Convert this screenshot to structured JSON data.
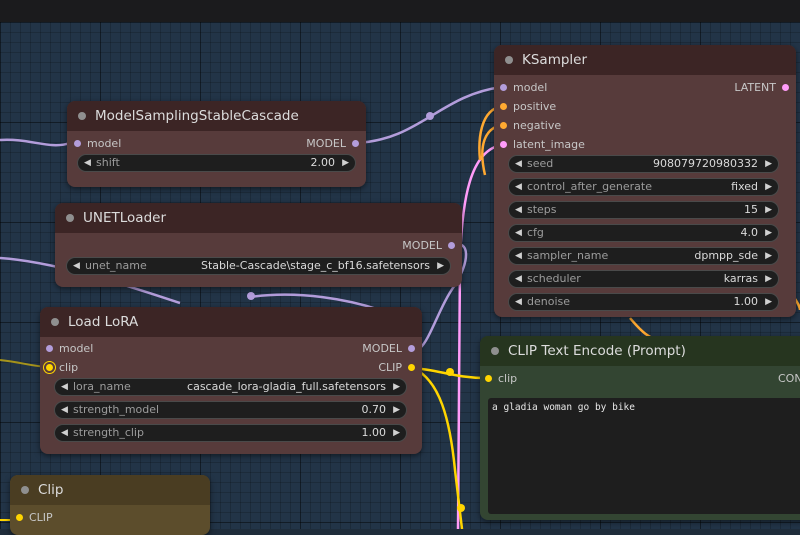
{
  "colors": {
    "model": "#b39ddb",
    "clip": "#ffd500",
    "conditioning": "#ffa931",
    "latent": "#ff9cf9",
    "node_body": "#573b3b",
    "node_title": "#3c2525",
    "canvas": "#223447"
  },
  "ksampler": {
    "title": "KSampler",
    "inputs": [
      "model",
      "positive",
      "negative",
      "latent_image"
    ],
    "output": "LATENT",
    "widgets": [
      {
        "label": "seed",
        "value": "908079720980332"
      },
      {
        "label": "control_after_generate",
        "value": "fixed"
      },
      {
        "label": "steps",
        "value": "15"
      },
      {
        "label": "cfg",
        "value": "4.0"
      },
      {
        "label": "sampler_name",
        "value": "dpmpp_sde"
      },
      {
        "label": "scheduler",
        "value": "karras"
      },
      {
        "label": "denoise",
        "value": "1.00"
      }
    ]
  },
  "model_sampling": {
    "title": "ModelSamplingStableCascade",
    "input": "model",
    "output": "MODEL",
    "widget": {
      "label": "shift",
      "value": "2.00"
    }
  },
  "unet_loader": {
    "title": "UNETLoader",
    "output": "MODEL",
    "widget": {
      "label": "unet_name",
      "value": "Stable-Cascade\\stage_c_bf16.safetensors"
    }
  },
  "load_lora": {
    "title": "Load LoRA",
    "inputs": [
      "model",
      "clip"
    ],
    "outputs": [
      "MODEL",
      "CLIP"
    ],
    "widgets": [
      {
        "label": "lora_name",
        "value": "cascade_lora-gladia_full.safetensors"
      },
      {
        "label": "strength_model",
        "value": "0.70"
      },
      {
        "label": "strength_clip",
        "value": "1.00"
      }
    ]
  },
  "clip_text_encode": {
    "title": "CLIP Text Encode (Prompt)",
    "input": "clip",
    "output_partial": "CONI",
    "text": "a gladia woman go by bike"
  },
  "clip_node": {
    "title": "Clip",
    "output": "CLIP"
  }
}
